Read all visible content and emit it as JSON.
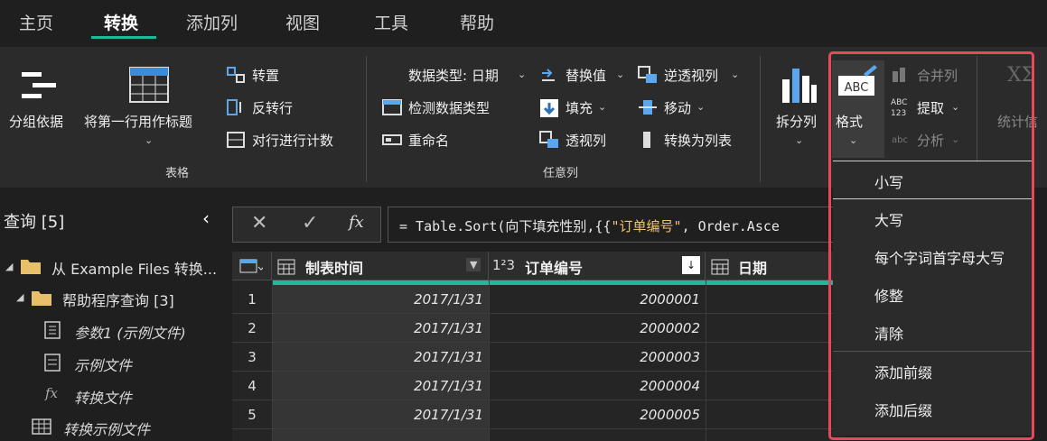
{
  "menu": {
    "tabs": [
      "主页",
      "转换",
      "添加列",
      "视图",
      "工具",
      "帮助"
    ],
    "active": 1
  },
  "ribbon": {
    "group_by": "分组依据",
    "use_first_row": "将第一行用作标题",
    "transpose": "转置",
    "reverse_rows": "反转行",
    "count_rows": "对行进行计数",
    "table_group": "表格",
    "data_type": "数据类型: 日期",
    "detect_type": "检测数据类型",
    "rename": "重命名",
    "replace_values": "替换值",
    "fill": "填充",
    "pivot": "透视列",
    "unpivot": "逆透视列",
    "move": "移动",
    "to_list": "转换为列表",
    "any_column_group": "任意列",
    "split_column": "拆分列",
    "format": "格式",
    "merge_columns": "合并列",
    "extract": "提取",
    "parse": "分析",
    "statistics": "统计信"
  },
  "queries": {
    "title": "查询 [5]",
    "items": [
      "从 Example Files 转换...",
      "帮助程序查询 [3]",
      "参数1 (示例文件)",
      "示例文件",
      "转换文件",
      "转换示例文件"
    ]
  },
  "formula": {
    "prefix": "= Table.Sort(向下填充性别,{{",
    "str": "\"订单编号\"",
    "suffix": ", Order.Asce"
  },
  "grid": {
    "columns": [
      {
        "name": "制表时间",
        "type_icon": "calendar-icon"
      },
      {
        "name": "订单编号",
        "type_icon": "integer-icon"
      },
      {
        "name": "日期",
        "type_icon": "calendar-icon"
      }
    ],
    "rows": [
      {
        "n": "1",
        "date": "2017/1/31",
        "order": "2000001"
      },
      {
        "n": "2",
        "date": "2017/1/31",
        "order": "2000002"
      },
      {
        "n": "3",
        "date": "2017/1/31",
        "order": "2000003"
      },
      {
        "n": "4",
        "date": "2017/1/31",
        "order": "2000004"
      },
      {
        "n": "5",
        "date": "2017/1/31",
        "order": "2000005"
      }
    ]
  },
  "format_menu": {
    "items": [
      "小写",
      "大写",
      "每个字词首字母大写",
      "修整",
      "清除",
      "添加前缀",
      "添加后缀"
    ]
  },
  "colors": {
    "accent": "#1fb89d",
    "highlight": "#e8475c"
  }
}
